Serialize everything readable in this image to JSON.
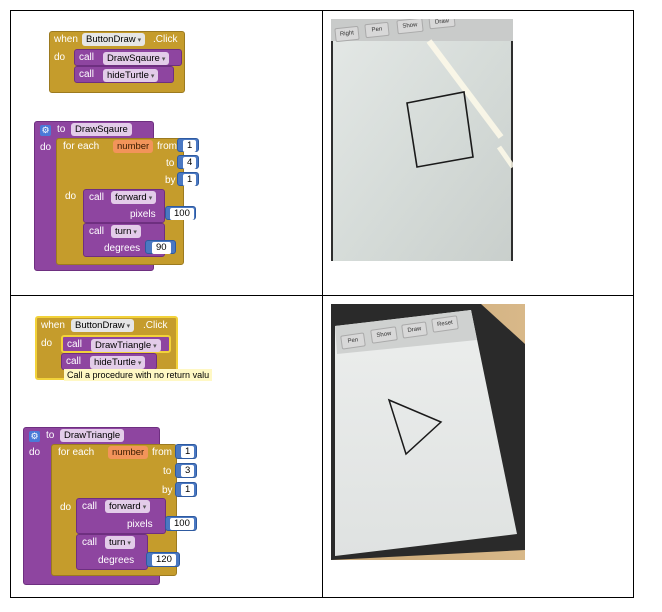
{
  "top": {
    "event": {
      "when": "when",
      "component": "ButtonDraw",
      "event": ".Click",
      "do": "do"
    },
    "calls": [
      {
        "call": "call",
        "proc": "DrawSqaure"
      },
      {
        "call": "call",
        "proc": "hideTurtle"
      }
    ],
    "procedure": {
      "to": "to",
      "name": "DrawSqaure",
      "do": "do",
      "for_each": "for each",
      "var": "number",
      "from_label": "from",
      "from": "1",
      "to_label": "to",
      "to_value": "4",
      "by_label": "by",
      "by": "1",
      "loop_do": "do",
      "forward": {
        "call": "call",
        "proc": "forward",
        "param": "pixels",
        "value": "100"
      },
      "turn": {
        "call": "call",
        "proc": "turn",
        "param": "degrees",
        "value": "90"
      }
    },
    "phone_buttons": [
      "Right",
      "Pen",
      "Show",
      "Draw"
    ]
  },
  "bottom": {
    "event": {
      "when": "when",
      "component": "ButtonDraw",
      "event": ".Click",
      "do": "do"
    },
    "calls": [
      {
        "call": "call",
        "proc": "DrawTriangle"
      },
      {
        "call": "call",
        "proc": "hideTurtle"
      }
    ],
    "tooltip": "Call a procedure with no return valu",
    "procedure": {
      "to": "to",
      "name": "DrawTriangle",
      "do": "do",
      "for_each": "for each",
      "var": "number",
      "from_label": "from",
      "from": "1",
      "to_label": "to",
      "to_value": "3",
      "by_label": "by",
      "by": "1",
      "loop_do": "do",
      "forward": {
        "call": "call",
        "proc": "forward",
        "param": "pixels",
        "value": "100"
      },
      "turn": {
        "call": "call",
        "proc": "turn",
        "param": "degrees",
        "value": "120"
      }
    },
    "phone_buttons": [
      "Pen",
      "Show",
      "Draw",
      "Reset"
    ]
  },
  "colors": {
    "event_block": "#c59c2c",
    "procedure_block": "#8e45a0",
    "math_block": "#4a78c2",
    "variable_field": "#f2945a",
    "selection_outline": "#f2d23a"
  }
}
